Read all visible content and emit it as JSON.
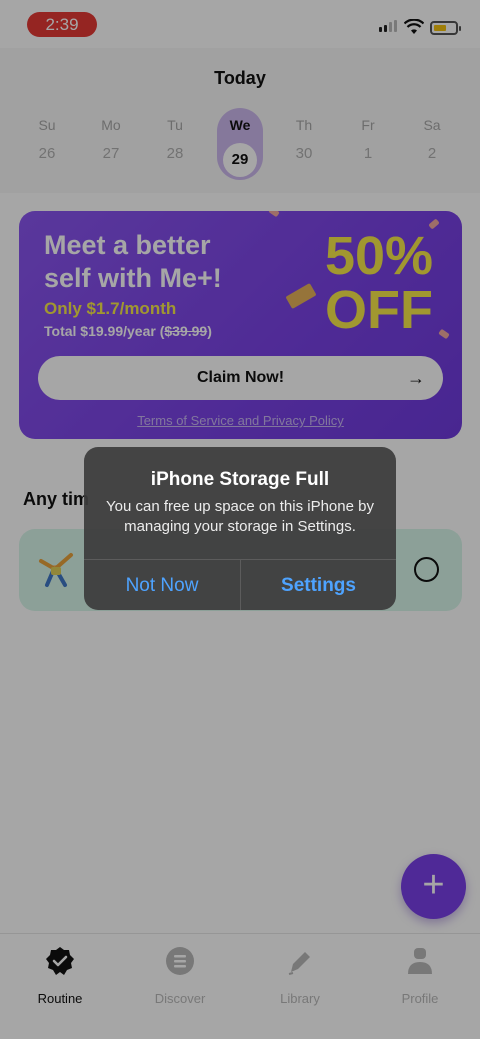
{
  "status": {
    "time": "2:39"
  },
  "header": {
    "title": "Today"
  },
  "week": [
    {
      "name": "Su",
      "date": "26"
    },
    {
      "name": "Mo",
      "date": "27"
    },
    {
      "name": "Tu",
      "date": "28"
    },
    {
      "name": "We",
      "date": "29",
      "active": true
    },
    {
      "name": "Th",
      "date": "30"
    },
    {
      "name": "Fr",
      "date": "1"
    },
    {
      "name": "Sa",
      "date": "2"
    }
  ],
  "promo": {
    "headline_line1": "Meet a better",
    "headline_line2": "self with Me+!",
    "price": "Only $1.7/month",
    "total_prefix": "Total $19.99/year (",
    "total_strike": "$39.99",
    "total_suffix": ")",
    "discount_line1": "50%",
    "discount_line2": "OFF",
    "cta_label": "Claim Now!",
    "cta_arrow": "→",
    "terms": "Terms of Service and Privacy Policy"
  },
  "section": {
    "label": "Any tim"
  },
  "fab": {
    "label": "+"
  },
  "tabs": [
    {
      "label": "Routine",
      "icon": "check-badge-icon",
      "active": true
    },
    {
      "label": "Discover",
      "icon": "list-icon"
    },
    {
      "label": "Library",
      "icon": "pencil-icon"
    },
    {
      "label": "Profile",
      "icon": "person-icon"
    }
  ],
  "alert": {
    "title": "iPhone Storage Full",
    "message": "You can free up space on this iPhone by managing your storage in Settings.",
    "cancel": "Not Now",
    "confirm": "Settings"
  },
  "colors": {
    "accent": "#7a40e8",
    "promo_yellow": "#f7e94a",
    "alert_button": "#4ea3ff",
    "recording_pill": "#e53935"
  }
}
